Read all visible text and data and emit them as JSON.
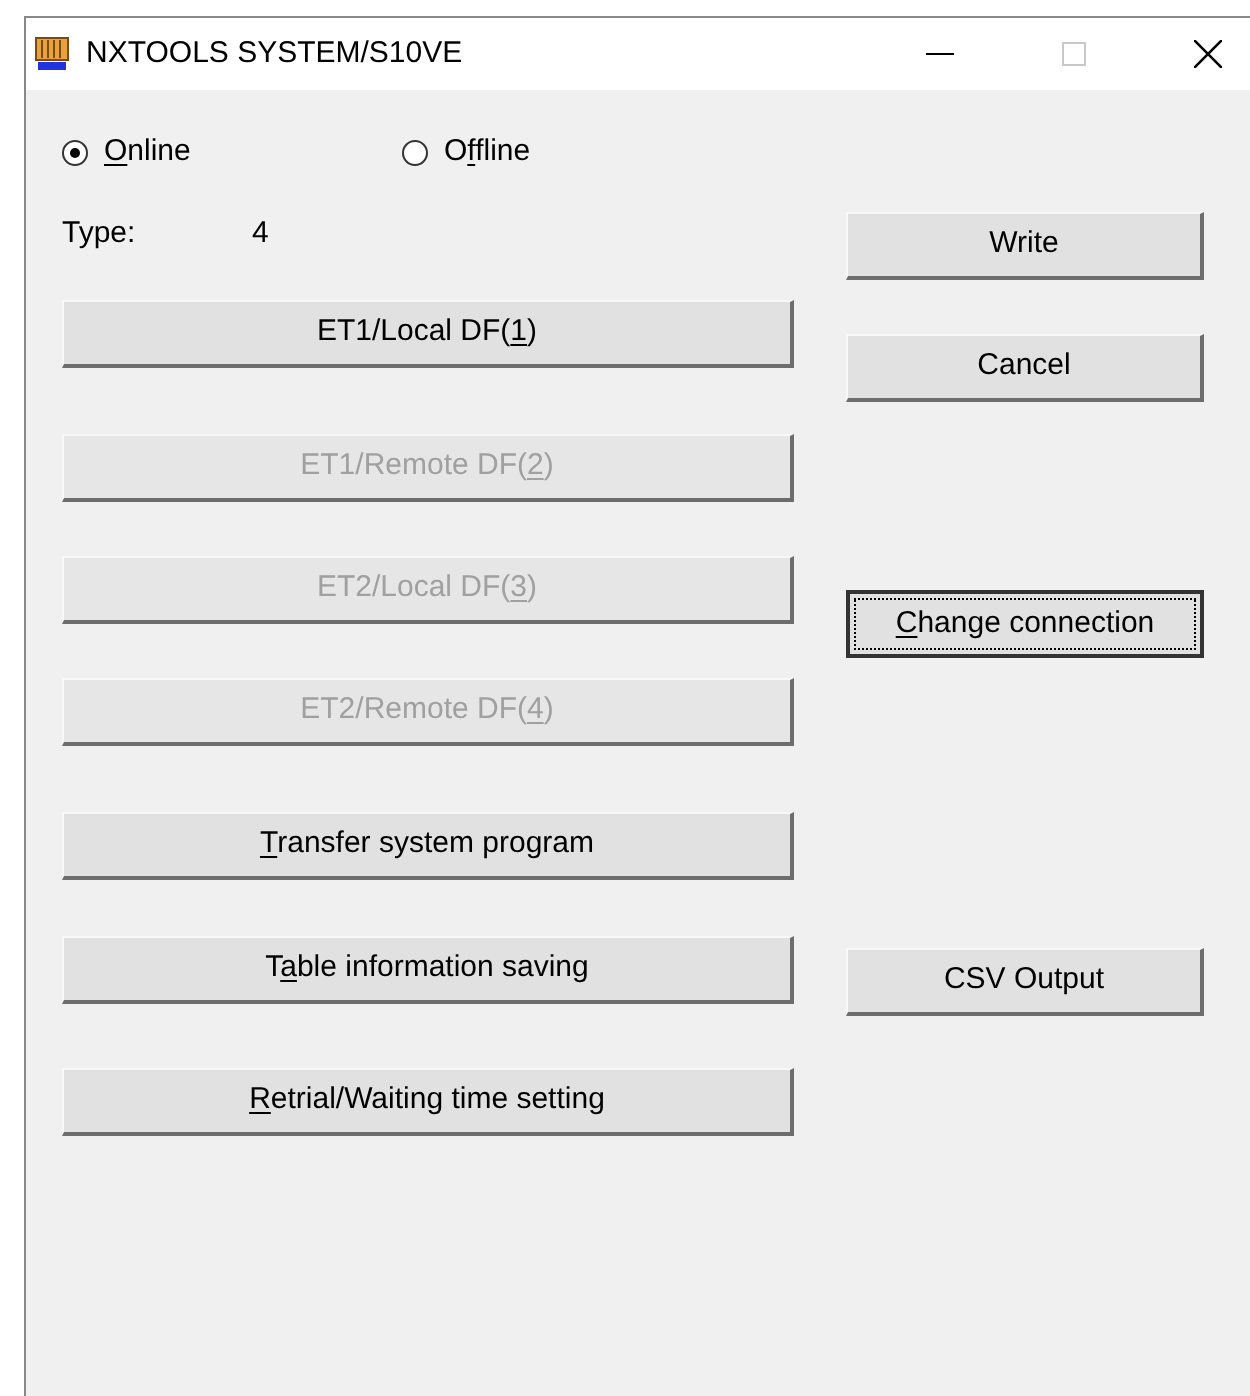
{
  "window": {
    "title": "NXTOOLS SYSTEM/S10VE",
    "maximize_disabled": true
  },
  "mode_radios": [
    {
      "key": "O",
      "after": "nline",
      "selected": true
    },
    {
      "before": "O",
      "key": "f",
      "after": "fline",
      "selected": false
    }
  ],
  "type": {
    "label": "Type:",
    "value": "4"
  },
  "left_buttons": [
    {
      "before": "ET1/Local DF(",
      "key": "1",
      "after": ")",
      "disabled": false
    },
    {
      "before": "ET1/Remote DF(",
      "key": "2",
      "after": ")",
      "disabled": true
    },
    {
      "before": "ET2/Local DF(",
      "key": "3",
      "after": ")",
      "disabled": true
    },
    {
      "before": "ET2/Remote DF(",
      "key": "4",
      "after": ")",
      "disabled": true
    },
    {
      "key": "T",
      "after": "ransfer system program",
      "disabled": false
    },
    {
      "before": "T",
      "key": "a",
      "after": "ble information saving",
      "disabled": false
    },
    {
      "key": "R",
      "after": "etrial/Waiting time setting",
      "disabled": false
    }
  ],
  "right_buttons": [
    {
      "before": "Write",
      "focused": false
    },
    {
      "before": "Cancel",
      "focused": false
    },
    {
      "key": "C",
      "after": "hange connection",
      "focused": true
    },
    {
      "before": "CSV Output",
      "focused": false
    }
  ]
}
